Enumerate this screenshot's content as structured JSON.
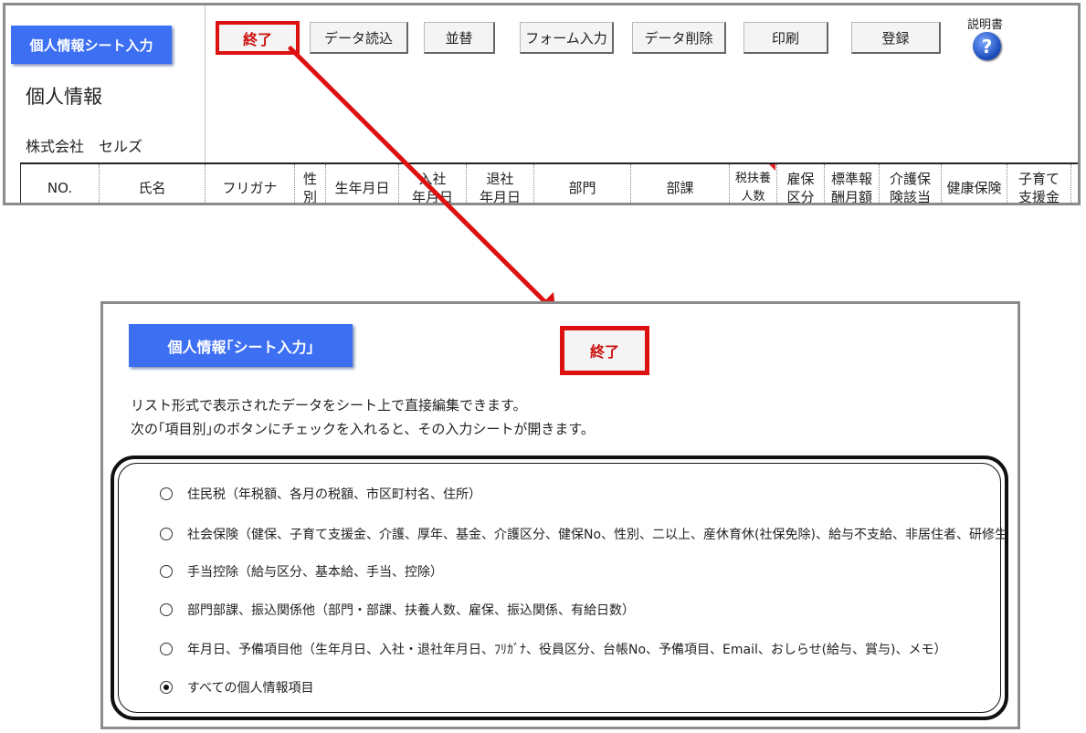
{
  "top": {
    "title": "個人情報シート入力",
    "heading": "個人情報",
    "company": "株式会社　セルズ",
    "help_label": "説明書",
    "help_icon": "question-icon",
    "toolbar": {
      "end": "終了",
      "load": "データ読込",
      "sort": "並替",
      "form_input": "フォーム入力",
      "delete": "データ削除",
      "print": "印刷",
      "register": "登録"
    },
    "columns": [
      "NO.",
      "氏名",
      "フリガナ",
      "性\n別",
      "生年月日",
      "入社\n年月日",
      "退社\n年月日",
      "部門",
      "部課",
      "税扶養\n人数",
      "雇保\n区分",
      "標準報\n酬月額",
      "介護保\n険該当",
      "健康保険",
      "子育て\n支援金"
    ]
  },
  "dialog": {
    "title": "個人情報｢シート入力｣",
    "end": "終了",
    "desc1": "リスト形式で表示されたデータをシート上で直接編集できます。",
    "desc2": "次の｢項目別｣のボタンにチェックを入れると、その入力シートが開きます。",
    "options": [
      {
        "label": "住民税（年税額、各月の税額、市区町村名、住所）",
        "selected": false
      },
      {
        "label": "社会保険（健保、子育て支援金、介護、厚年、基金、介護区分、健保No、性別、二以上、産休育休(社保免除)、給与不支給、非居住者、研修生",
        "selected": false
      },
      {
        "label": "手当控除（給与区分、基本給、手当、控除）",
        "selected": false
      },
      {
        "label": "部門部課、振込関係他（部門・部課、扶養人数、雇保、振込関係、有給日数）",
        "selected": false
      },
      {
        "label": "年月日、予備項目他（生年月日、入社・退社年月日、ﾌﾘｶﾞﾅ、役員区分、台帳No、予備項目、Email、おしらせ(給与、賞与)、メモ）",
        "selected": false
      },
      {
        "label": "すべての個人情報項目",
        "selected": true
      }
    ]
  },
  "colors": {
    "accent_blue": "#3d6ff2",
    "highlight_red": "#dd1111"
  }
}
